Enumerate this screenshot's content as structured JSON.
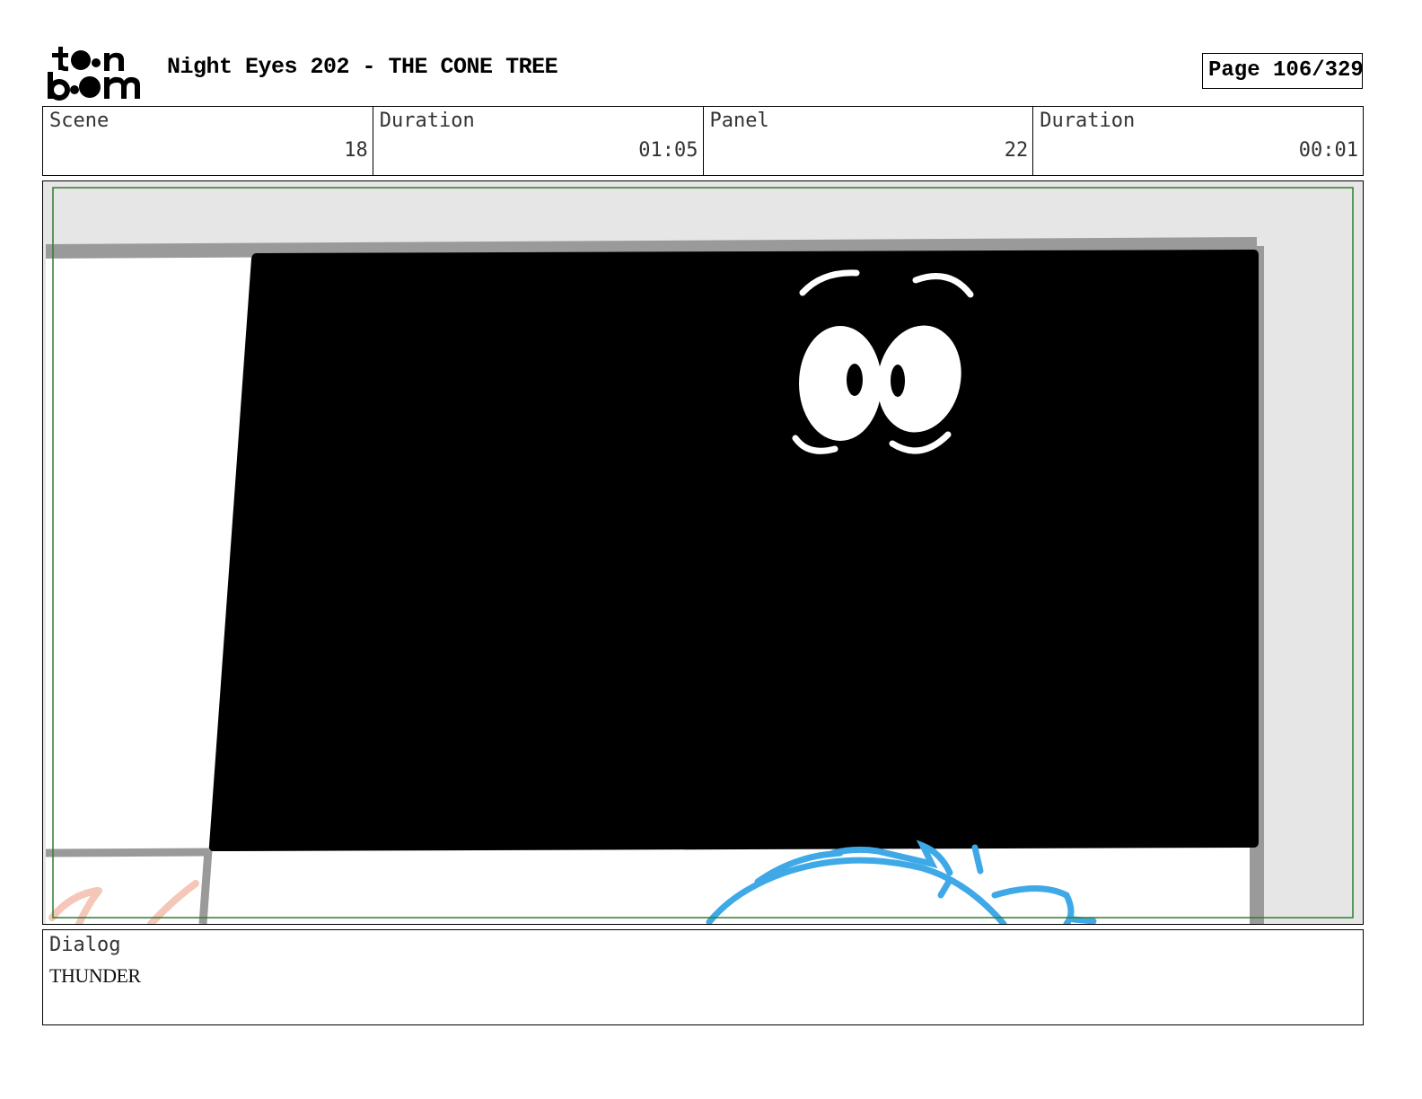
{
  "header": {
    "logo_text": "toon boom",
    "title": "Night Eyes 202 - THE CONE TREE",
    "page_label": "Page 106/329"
  },
  "info": [
    {
      "label": "Scene",
      "value": "18"
    },
    {
      "label": "Duration",
      "value": "01:05"
    },
    {
      "label": "Panel",
      "value": "22"
    },
    {
      "label": "Duration",
      "value": "00:01"
    }
  ],
  "panel_image": {
    "icons": [
      "night-eyes-character",
      "blue-sketch-character",
      "pink-sketch-marks"
    ],
    "colors": {
      "background": "#e6e6e6",
      "safe_frame": "#2f7d2f",
      "wall_line": "#9a9a9a",
      "dark_window": "#000000",
      "eyes": "#ffffff",
      "sketch_blue": "#3fa9e8",
      "sketch_pink": "#f4c7b8"
    }
  },
  "dialog": {
    "label": "Dialog",
    "text": "THUNDER"
  }
}
